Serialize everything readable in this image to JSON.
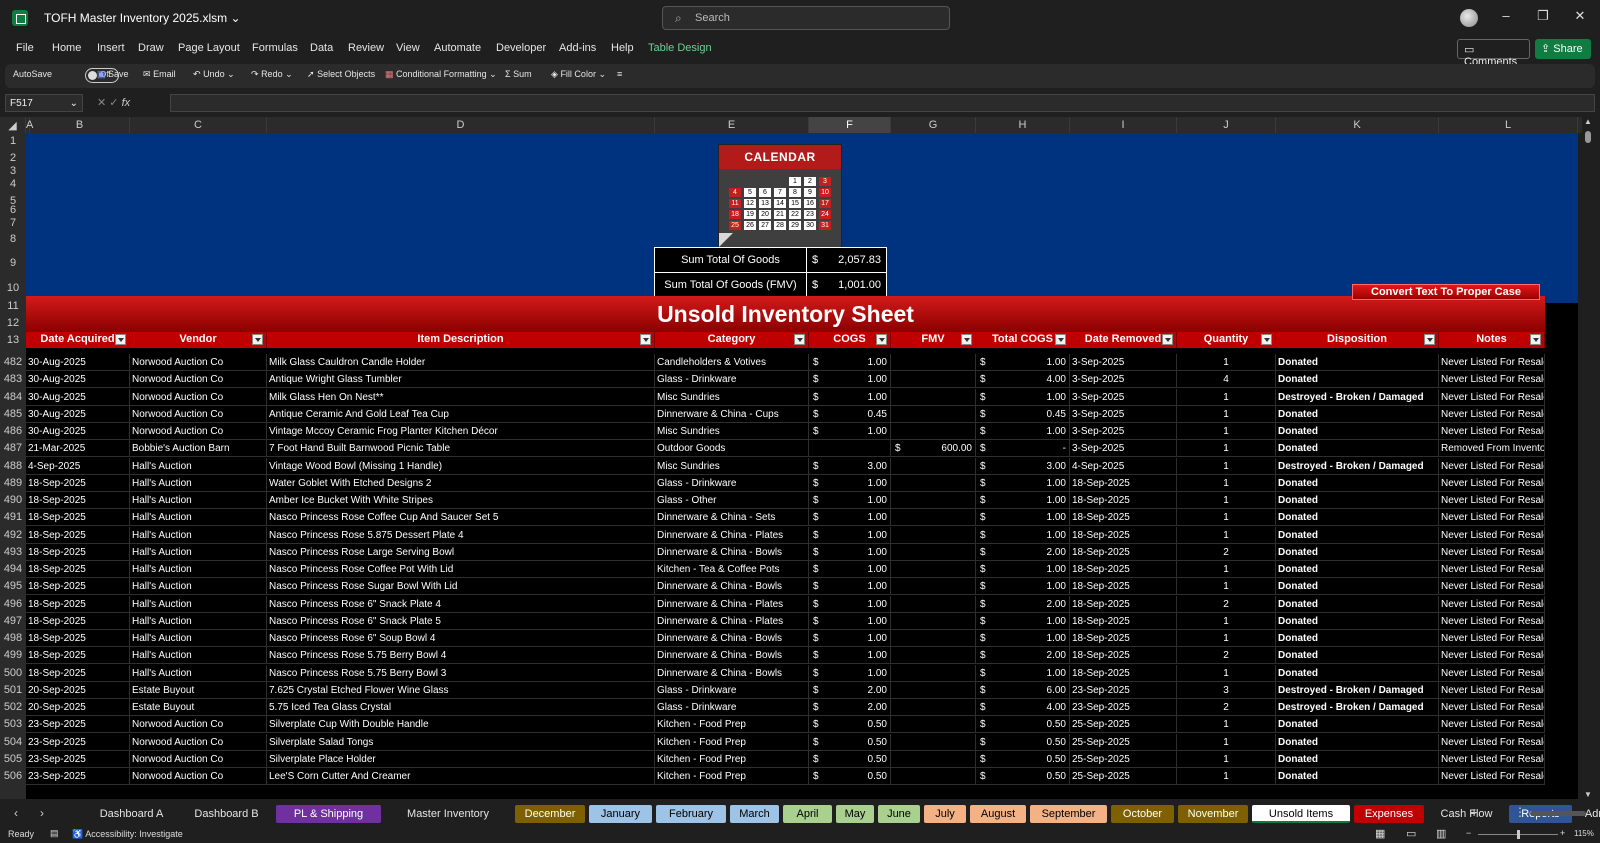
{
  "window": {
    "file_title": "TOFH Master Inventory 2025.xlsm",
    "search_placeholder": "Search",
    "zoom": "115%"
  },
  "menu": [
    "File",
    "Home",
    "Insert",
    "Draw",
    "Page Layout",
    "Formulas",
    "Data",
    "Review",
    "View",
    "Automate",
    "Developer",
    "Add-ins",
    "Help",
    "Table Design"
  ],
  "actions": {
    "comments": "Comments",
    "share": "Share"
  },
  "ribbon": {
    "autosave": "AutoSave",
    "autosave_state": "Off",
    "save": "Save",
    "email": "Email",
    "undo": "Undo",
    "redo": "Redo",
    "select_objects": "Select Objects",
    "conditional_formatting": "Conditional Formatting",
    "sum": "Sum",
    "fill_color": "Fill Color"
  },
  "formula_bar": {
    "name_box": "F517",
    "fx": "fx"
  },
  "columns": [
    "A",
    "B",
    "C",
    "D",
    "E",
    "F",
    "G",
    "H",
    "I",
    "J",
    "K",
    "L"
  ],
  "selected_column": "F",
  "row_numbers_top": [
    "1",
    "2",
    "3",
    "4",
    "5",
    "6",
    "7",
    "8",
    "9",
    "10",
    "11",
    "12",
    "13"
  ],
  "calendar": {
    "title": "CALENDAR",
    "days": [
      "1",
      "2",
      "3",
      "4",
      "5",
      "6",
      "7",
      "8",
      "9",
      "10",
      "11",
      "12",
      "13",
      "14",
      "15",
      "16",
      "17",
      "18",
      "19",
      "20",
      "21",
      "22",
      "23",
      "24",
      "25",
      "26",
      "27",
      "28",
      "29",
      "30",
      "31"
    ]
  },
  "summary": [
    {
      "label": "Sum Total Of Goods",
      "currency": "$",
      "value": "2,057.83"
    },
    {
      "label": "Sum Total Of Goods (FMV)",
      "currency": "$",
      "value": "1,001.00"
    }
  ],
  "convert_button": "Convert Text To Proper Case",
  "sheet_title": "Unsold Inventory Sheet",
  "table_headers": [
    "Date Acquired",
    "Vendor",
    "Item Description",
    "Category",
    "COGS",
    "FMV",
    "Total COGS",
    "Date Removed",
    "Quantity",
    "Disposition",
    "Notes"
  ],
  "rows": [
    {
      "n": "482",
      "date": "30-Aug-2025",
      "vendor": "Norwood Auction Co",
      "item": "Milk Glass Cauldron Candle Holder",
      "category": "Candleholders & Votives",
      "cogs": "1.00",
      "fmv": "",
      "total": "1.00",
      "removed": "3-Sep-2025",
      "qty": "1",
      "disp": "Donated",
      "notes": "Never Listed For Resale"
    },
    {
      "n": "483",
      "date": "30-Aug-2025",
      "vendor": "Norwood Auction Co",
      "item": "Antique Wright Glass Tumbler",
      "category": "Glass - Drinkware",
      "cogs": "1.00",
      "fmv": "",
      "total": "4.00",
      "removed": "3-Sep-2025",
      "qty": "4",
      "disp": "Donated",
      "notes": "Never Listed For Resale"
    },
    {
      "n": "484",
      "date": "30-Aug-2025",
      "vendor": "Norwood Auction Co",
      "item": "Milk Glass Hen On Nest**",
      "category": "Misc Sundries",
      "cogs": "1.00",
      "fmv": "",
      "total": "1.00",
      "removed": "3-Sep-2025",
      "qty": "1",
      "disp": "Destroyed - Broken / Damaged",
      "notes": "Never Listed For Resale"
    },
    {
      "n": "485",
      "date": "30-Aug-2025",
      "vendor": "Norwood Auction Co",
      "item": "Antique Ceramic And Gold Leaf Tea Cup",
      "category": "Dinnerware & China - Cups",
      "cogs": "0.45",
      "fmv": "",
      "total": "0.45",
      "removed": "3-Sep-2025",
      "qty": "1",
      "disp": "Donated",
      "notes": "Never Listed For Resale"
    },
    {
      "n": "486",
      "date": "30-Aug-2025",
      "vendor": "Norwood Auction Co",
      "item": "Vintage Mccoy Ceramic Frog Planter Kitchen Décor",
      "category": "Misc Sundries",
      "cogs": "1.00",
      "fmv": "",
      "total": "1.00",
      "removed": "3-Sep-2025",
      "qty": "1",
      "disp": "Donated",
      "notes": "Never Listed For Resale"
    },
    {
      "n": "487",
      "date": "21-Mar-2025",
      "vendor": "Bobbie's Auction Barn",
      "item": "7 Foot Hand Built Barnwood Picnic Table",
      "category": "Outdoor Goods",
      "cogs": "",
      "fmv": "600.00",
      "total": "-",
      "removed": "3-Sep-2025",
      "qty": "1",
      "disp": "Donated",
      "notes": "Removed From Inventory"
    },
    {
      "n": "488",
      "date": "4-Sep-2025",
      "vendor": "Hall's Auction",
      "item": "Vintage Wood Bowl (Missing 1 Handle)",
      "category": "Misc Sundries",
      "cogs": "3.00",
      "fmv": "",
      "total": "3.00",
      "removed": "4-Sep-2025",
      "qty": "1",
      "disp": "Destroyed - Broken / Damaged",
      "notes": "Never Listed For Resale"
    },
    {
      "n": "489",
      "date": "18-Sep-2025",
      "vendor": "Hall's Auction",
      "item": "Water Goblet With Etched Designs 2",
      "category": "Glass - Drinkware",
      "cogs": "1.00",
      "fmv": "",
      "total": "1.00",
      "removed": "18-Sep-2025",
      "qty": "1",
      "disp": "Donated",
      "notes": "Never Listed For Resale"
    },
    {
      "n": "490",
      "date": "18-Sep-2025",
      "vendor": "Hall's Auction",
      "item": "Amber Ice Bucket With White Stripes",
      "category": "Glass - Other",
      "cogs": "1.00",
      "fmv": "",
      "total": "1.00",
      "removed": "18-Sep-2025",
      "qty": "1",
      "disp": "Donated",
      "notes": "Never Listed For Resale"
    },
    {
      "n": "491",
      "date": "18-Sep-2025",
      "vendor": "Hall's Auction",
      "item": "Nasco Princess Rose Coffee Cup And Saucer Set 5",
      "category": "Dinnerware & China - Sets",
      "cogs": "1.00",
      "fmv": "",
      "total": "1.00",
      "removed": "18-Sep-2025",
      "qty": "1",
      "disp": "Donated",
      "notes": "Never Listed For Resale"
    },
    {
      "n": "492",
      "date": "18-Sep-2025",
      "vendor": "Hall's Auction",
      "item": "Nasco Princess Rose 5.875 Dessert Plate 4",
      "category": "Dinnerware & China - Plates",
      "cogs": "1.00",
      "fmv": "",
      "total": "1.00",
      "removed": "18-Sep-2025",
      "qty": "1",
      "disp": "Donated",
      "notes": "Never Listed For Resale"
    },
    {
      "n": "493",
      "date": "18-Sep-2025",
      "vendor": "Hall's Auction",
      "item": "Nasco Princess Rose Large Serving Bowl",
      "category": "Dinnerware & China - Bowls",
      "cogs": "1.00",
      "fmv": "",
      "total": "2.00",
      "removed": "18-Sep-2025",
      "qty": "2",
      "disp": "Donated",
      "notes": "Never Listed For Resale"
    },
    {
      "n": "494",
      "date": "18-Sep-2025",
      "vendor": "Hall's Auction",
      "item": "Nasco Princess Rose Coffee Pot With Lid",
      "category": "Kitchen - Tea & Coffee Pots",
      "cogs": "1.00",
      "fmv": "",
      "total": "1.00",
      "removed": "18-Sep-2025",
      "qty": "1",
      "disp": "Donated",
      "notes": "Never Listed For Resale"
    },
    {
      "n": "495",
      "date": "18-Sep-2025",
      "vendor": "Hall's Auction",
      "item": "Nasco Princess Rose Sugar Bowl With Lid",
      "category": "Dinnerware & China - Bowls",
      "cogs": "1.00",
      "fmv": "",
      "total": "1.00",
      "removed": "18-Sep-2025",
      "qty": "1",
      "disp": "Donated",
      "notes": "Never Listed For Resale"
    },
    {
      "n": "496",
      "date": "18-Sep-2025",
      "vendor": "Hall's Auction",
      "item": "Nasco Princess Rose 6\" Snack Plate 4",
      "category": "Dinnerware & China - Plates",
      "cogs": "1.00",
      "fmv": "",
      "total": "2.00",
      "removed": "18-Sep-2025",
      "qty": "2",
      "disp": "Donated",
      "notes": "Never Listed For Resale"
    },
    {
      "n": "497",
      "date": "18-Sep-2025",
      "vendor": "Hall's Auction",
      "item": "Nasco Princess Rose 6\" Snack Plate 5",
      "category": "Dinnerware & China - Plates",
      "cogs": "1.00",
      "fmv": "",
      "total": "1.00",
      "removed": "18-Sep-2025",
      "qty": "1",
      "disp": "Donated",
      "notes": "Never Listed For Resale"
    },
    {
      "n": "498",
      "date": "18-Sep-2025",
      "vendor": "Hall's Auction",
      "item": "Nasco Princess Rose 6\" Soup Bowl 4",
      "category": "Dinnerware & China - Bowls",
      "cogs": "1.00",
      "fmv": "",
      "total": "1.00",
      "removed": "18-Sep-2025",
      "qty": "1",
      "disp": "Donated",
      "notes": "Never Listed For Resale"
    },
    {
      "n": "499",
      "date": "18-Sep-2025",
      "vendor": "Hall's Auction",
      "item": "Nasco Princess Rose 5.75 Berry Bowl 4",
      "category": "Dinnerware & China - Bowls",
      "cogs": "1.00",
      "fmv": "",
      "total": "2.00",
      "removed": "18-Sep-2025",
      "qty": "2",
      "disp": "Donated",
      "notes": "Never Listed For Resale"
    },
    {
      "n": "500",
      "date": "18-Sep-2025",
      "vendor": "Hall's Auction",
      "item": "Nasco Princess Rose 5.75 Berry Bowl 3",
      "category": "Dinnerware & China - Bowls",
      "cogs": "1.00",
      "fmv": "",
      "total": "1.00",
      "removed": "18-Sep-2025",
      "qty": "1",
      "disp": "Donated",
      "notes": "Never Listed For Resale"
    },
    {
      "n": "501",
      "date": "20-Sep-2025",
      "vendor": "Estate Buyout",
      "item": "7.625 Crystal Etched Flower Wine Glass",
      "category": "Glass - Drinkware",
      "cogs": "2.00",
      "fmv": "",
      "total": "6.00",
      "removed": "23-Sep-2025",
      "qty": "3",
      "disp": "Destroyed - Broken / Damaged",
      "notes": "Never Listed For Resale"
    },
    {
      "n": "502",
      "date": "20-Sep-2025",
      "vendor": "Estate Buyout",
      "item": "5.75 Iced Tea Glass Crystal",
      "category": "Glass - Drinkware",
      "cogs": "2.00",
      "fmv": "",
      "total": "4.00",
      "removed": "23-Sep-2025",
      "qty": "2",
      "disp": "Destroyed - Broken / Damaged",
      "notes": "Never Listed For Resale"
    },
    {
      "n": "503",
      "date": "23-Sep-2025",
      "vendor": "Norwood Auction Co",
      "item": "Silverplate Cup With Double Handle",
      "category": "Kitchen - Food Prep",
      "cogs": "0.50",
      "fmv": "",
      "total": "0.50",
      "removed": "25-Sep-2025",
      "qty": "1",
      "disp": "Donated",
      "notes": "Never Listed For Resale"
    },
    {
      "n": "504",
      "date": "23-Sep-2025",
      "vendor": "Norwood Auction Co",
      "item": "Silverplate Salad Tongs",
      "category": "Kitchen - Food Prep",
      "cogs": "0.50",
      "fmv": "",
      "total": "0.50",
      "removed": "25-Sep-2025",
      "qty": "1",
      "disp": "Donated",
      "notes": "Never Listed For Resale"
    },
    {
      "n": "505",
      "date": "23-Sep-2025",
      "vendor": "Norwood Auction Co",
      "item": "Silverplate Place Holder",
      "category": "Kitchen - Food Prep",
      "cogs": "0.50",
      "fmv": "",
      "total": "0.50",
      "removed": "25-Sep-2025",
      "qty": "1",
      "disp": "Donated",
      "notes": "Never Listed For Resale"
    },
    {
      "n": "506",
      "date": "23-Sep-2025",
      "vendor": "Norwood Auction Co",
      "item": "Lee'S Corn Cutter And Creamer",
      "category": "Kitchen - Food Prep",
      "cogs": "0.50",
      "fmv": "",
      "total": "0.50",
      "removed": "25-Sep-2025",
      "qty": "1",
      "disp": "Donated",
      "notes": "Never Listed For Resale"
    }
  ],
  "sheet_tabs": [
    {
      "label": "Dashboard A",
      "bg": "#1f1f1f",
      "fg": "#e6e6e6"
    },
    {
      "label": "Dashboard B",
      "bg": "#1f1f1f",
      "fg": "#e6e6e6"
    },
    {
      "label": "PL & Shipping",
      "bg": "#7030a0",
      "fg": "#ffffff"
    },
    {
      "label": "Master Inventory",
      "bg": "#1f1f1f",
      "fg": "#e6e6e6"
    },
    {
      "label": "December",
      "bg": "#7f6000",
      "fg": "#ffffff"
    },
    {
      "label": "January",
      "bg": "#9dc3e6",
      "fg": "#000000"
    },
    {
      "label": "February",
      "bg": "#9dc3e6",
      "fg": "#000000"
    },
    {
      "label": "March",
      "bg": "#9dc3e6",
      "fg": "#000000"
    },
    {
      "label": "April",
      "bg": "#a9d08e",
      "fg": "#000000"
    },
    {
      "label": "May",
      "bg": "#a9d08e",
      "fg": "#000000"
    },
    {
      "label": "June",
      "bg": "#a9d08e",
      "fg": "#000000"
    },
    {
      "label": "July",
      "bg": "#f4b183",
      "fg": "#000000"
    },
    {
      "label": "August",
      "bg": "#f4b183",
      "fg": "#000000"
    },
    {
      "label": "September",
      "bg": "#f4b183",
      "fg": "#000000"
    },
    {
      "label": "October",
      "bg": "#7f6000",
      "fg": "#ffffff"
    },
    {
      "label": "November",
      "bg": "#7f6000",
      "fg": "#ffffff"
    },
    {
      "label": "Unsold Items",
      "bg": "#ffffff",
      "fg": "#000000"
    },
    {
      "label": "Expenses",
      "bg": "#c00000",
      "fg": "#ffffff"
    },
    {
      "label": "Cash Flow",
      "bg": "#1f1f1f",
      "fg": "#e6e6e6"
    },
    {
      "label": "Reports",
      "bg": "#2f5597",
      "fg": "#ffffff"
    },
    {
      "label": "Admin",
      "bg": "#1f1f1f",
      "fg": "#e6e6e6"
    }
  ],
  "status": {
    "ready": "Ready",
    "accessibility": "Accessibility: Investigate"
  }
}
